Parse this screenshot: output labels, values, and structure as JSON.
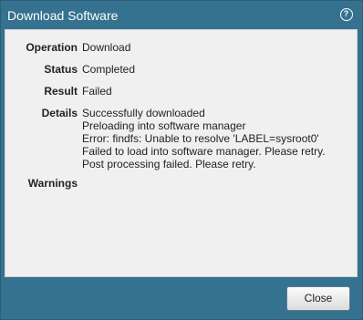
{
  "dialog": {
    "title": "Download Software",
    "help_icon_glyph": "?"
  },
  "fields": {
    "operation": {
      "label": "Operation",
      "value": "Download"
    },
    "status": {
      "label": "Status",
      "value": "Completed"
    },
    "result": {
      "label": "Result",
      "value": "Failed"
    },
    "details": {
      "label": "Details",
      "lines": [
        "Successfully downloaded",
        "Preloading into software manager",
        "Error: findfs: Unable to resolve 'LABEL=sysroot0'",
        "Failed to load into software manager. Please retry.",
        "Post processing failed. Please retry."
      ]
    },
    "warnings": {
      "label": "Warnings",
      "value": ""
    }
  },
  "footer": {
    "close_label": "Close"
  }
}
